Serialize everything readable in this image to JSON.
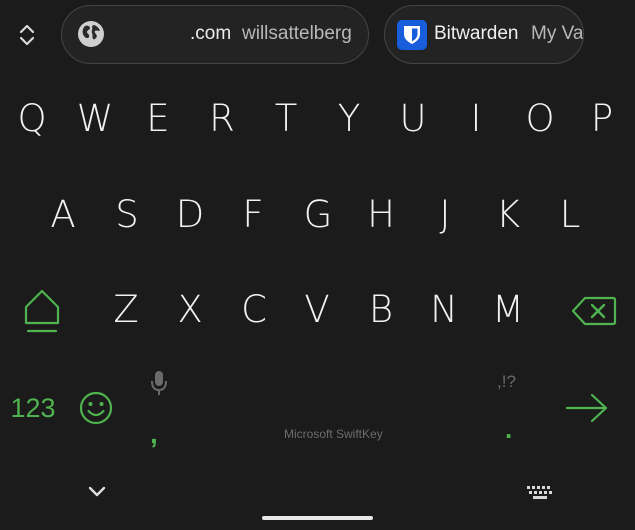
{
  "suggestions": {
    "url_item": {
      "domain": ".com",
      "user": "willsattelberg",
      "icon": "globe-icon"
    },
    "bitwarden_item": {
      "name": "Bitwarden",
      "vault": "My Va",
      "icon": "bitwarden-shield-icon"
    }
  },
  "keys": {
    "row1": [
      "Q",
      "W",
      "E",
      "R",
      "T",
      "Y",
      "U",
      "I",
      "O",
      "P"
    ],
    "row2": [
      "A",
      "S",
      "D",
      "F",
      "G",
      "H",
      "J",
      "K",
      "L"
    ],
    "row3": [
      "Z",
      "X",
      "C",
      "V",
      "B",
      "N",
      "M"
    ]
  },
  "bottom": {
    "numbers_label": "123",
    "comma": ",",
    "brand": "Microsoft SwiftKey",
    "punct_hint": ",!?",
    "period": "."
  },
  "colors": {
    "background": "#1b1b1b",
    "accent": "#4fb34f",
    "key_text": "#f2f2f2",
    "pill_bg": "#232323",
    "pill_border": "#444444",
    "bitwarden_blue": "#175ddc"
  }
}
